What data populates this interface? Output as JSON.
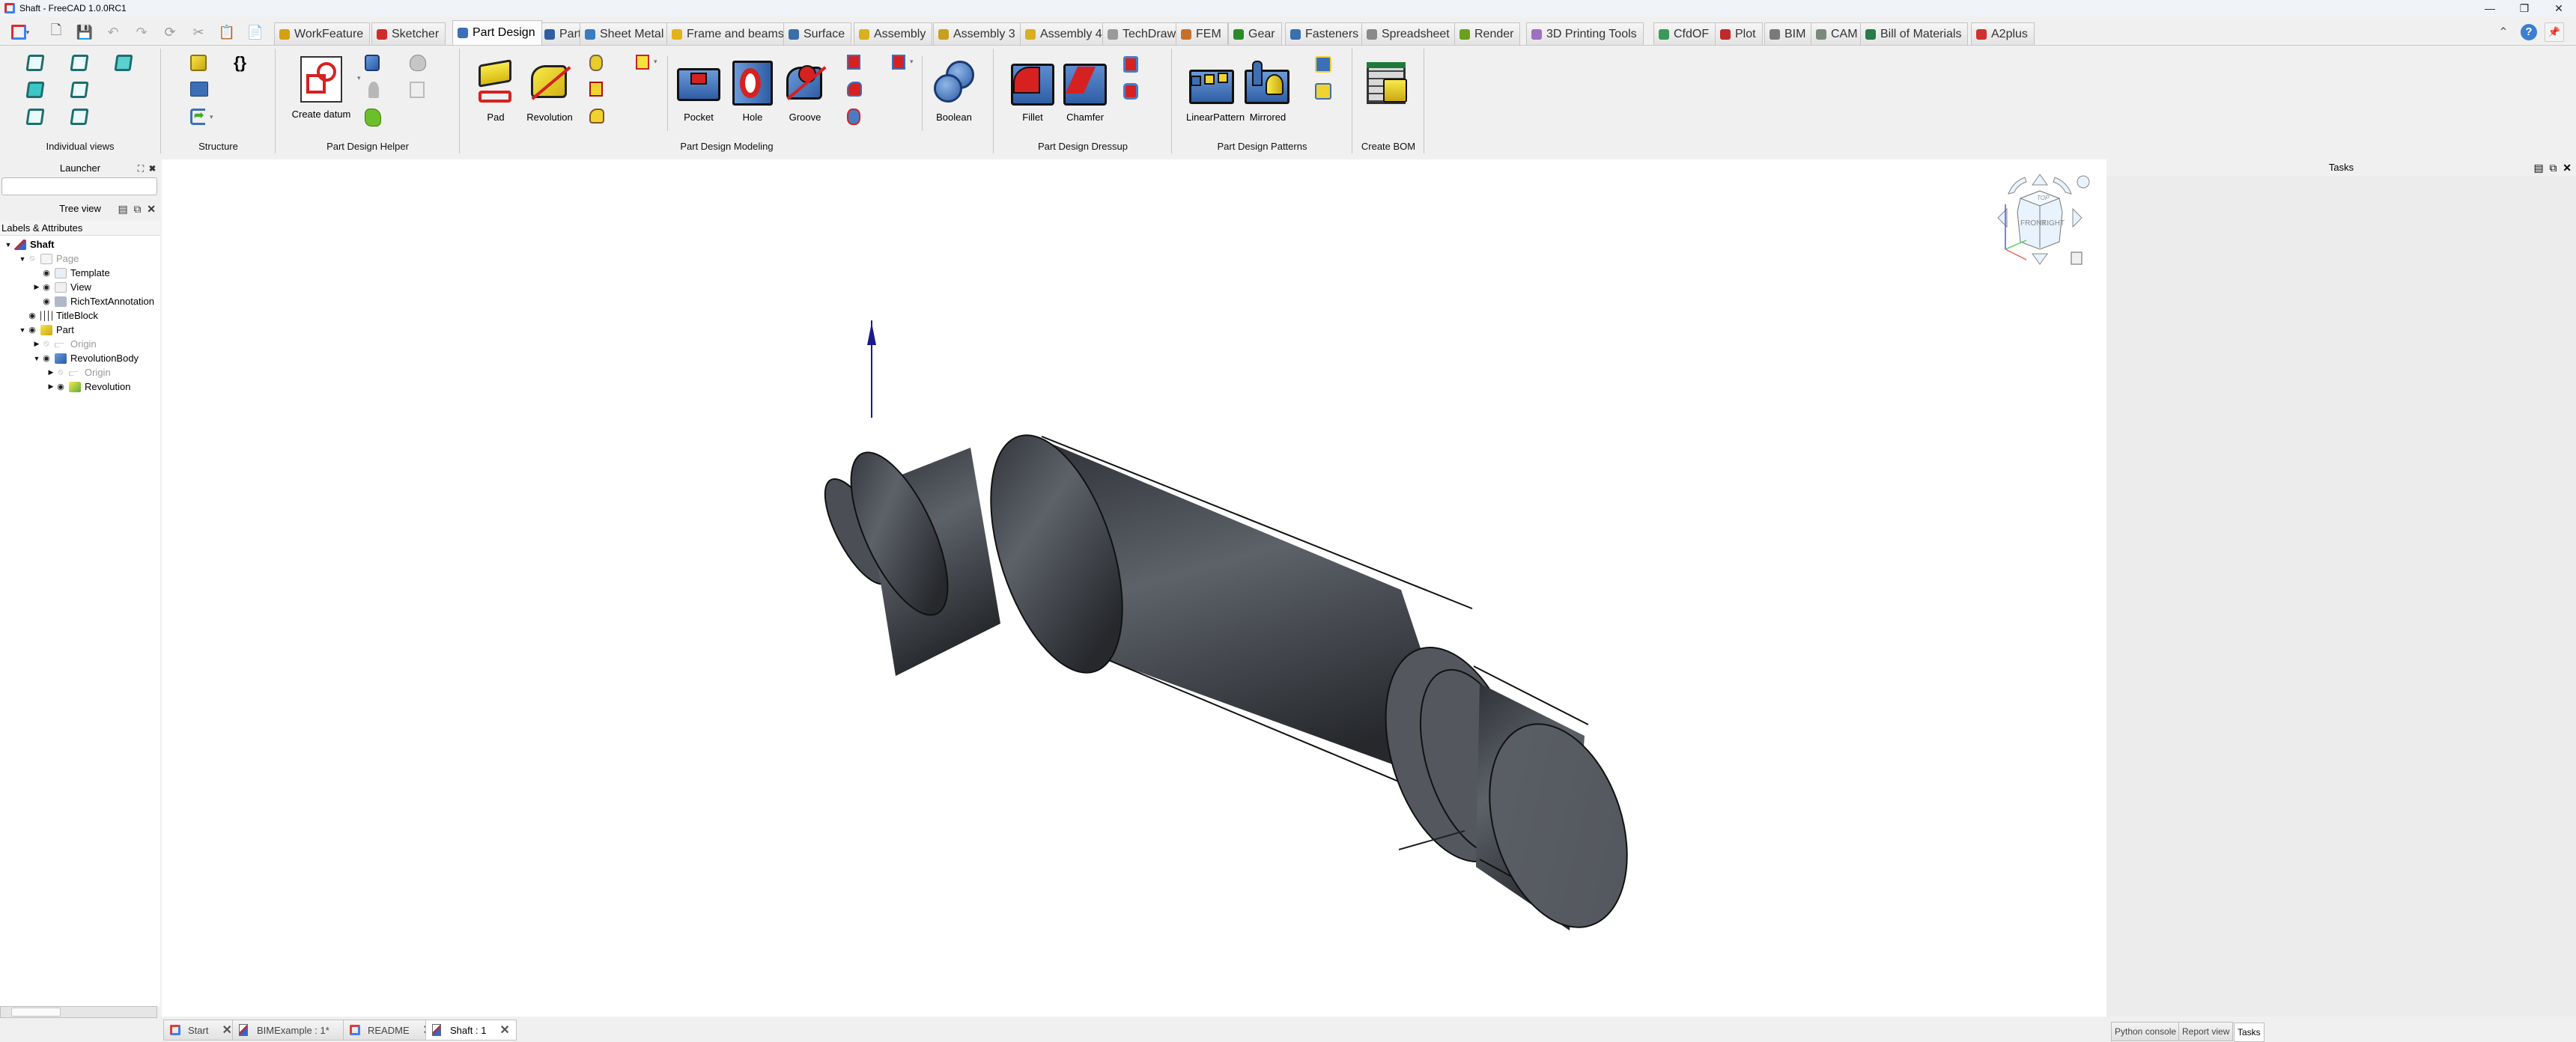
{
  "window": {
    "title": "Shaft - FreeCAD 1.0.0RC1",
    "controls": [
      "minimize",
      "restore",
      "close"
    ]
  },
  "quick_toolbar": [
    {
      "name": "freecad-menu",
      "icon": "freecad-logo-icon"
    },
    {
      "name": "new",
      "icon": "new-document-icon"
    },
    {
      "name": "save",
      "icon": "save-icon"
    },
    {
      "name": "undo",
      "icon": "undo-icon"
    },
    {
      "name": "redo",
      "icon": "redo-icon"
    },
    {
      "name": "refresh",
      "icon": "refresh-icon"
    },
    {
      "name": "cut",
      "icon": "cut-icon"
    },
    {
      "name": "copy",
      "icon": "copy-icon"
    },
    {
      "name": "paste",
      "icon": "paste-icon"
    }
  ],
  "workbench_tabs": [
    {
      "label": "WorkFeature",
      "color": "#d4a017"
    },
    {
      "label": "Sketcher",
      "color": "#d02a2a"
    },
    {
      "label": "Part Design",
      "color": "#3d6fb6",
      "active": true
    },
    {
      "label": "Part",
      "color": "#2f5fa0"
    },
    {
      "label": "Sheet Metal",
      "color": "#3b7bbf"
    },
    {
      "label": "Frame and beams",
      "color": "#e2b31a"
    },
    {
      "label": "Surface",
      "color": "#3b6ea8"
    },
    {
      "label": "Assembly",
      "color": "#d8b020"
    },
    {
      "label": "Assembly 3",
      "color": "#c8a020"
    },
    {
      "label": "Assembly 4",
      "color": "#d8b020"
    },
    {
      "label": "TechDraw",
      "color": "#9a9a9a"
    },
    {
      "label": "FEM",
      "color": "#c8702a"
    },
    {
      "label": "Gear",
      "color": "#2a8a2a"
    },
    {
      "label": "Fasteners",
      "color": "#3a6fb0"
    },
    {
      "label": "Spreadsheet",
      "color": "#8a8a8a"
    },
    {
      "label": "Render",
      "color": "#6aa020"
    },
    {
      "label": "3D Printing Tools",
      "color": "#a070c0"
    },
    {
      "label": "CfdOF",
      "color": "#3a9a5a"
    },
    {
      "label": "Plot",
      "color": "#c02a2a"
    },
    {
      "label": "BIM",
      "color": "#7a7a7a"
    },
    {
      "label": "CAM",
      "color": "#7a8a7a"
    },
    {
      "label": "Bill of Materials",
      "color": "#2a7a4a"
    },
    {
      "label": "A2plus",
      "color": "#d03030"
    }
  ],
  "ribbon_right": {
    "collapse": "chevron-up-icon",
    "help": "help-icon",
    "pin": "pin-icon"
  },
  "ribbon_groups": [
    {
      "label": "Individual views",
      "buttons": [
        "Isometric",
        "Front",
        "Top",
        "Right",
        "Rear",
        "Bottom",
        "Left"
      ]
    },
    {
      "label": "Structure",
      "buttons": [
        "Create part",
        "Create variable set",
        "Create group",
        "Link actions"
      ]
    },
    {
      "label": "Part Design Helper",
      "buttons": [
        {
          "label": "Create datum"
        },
        "Create body",
        "Shape binder",
        "Clone",
        "Sub-shape binder",
        "Validate sketch",
        "Create sketch"
      ]
    },
    {
      "label": "Part Design Modeling",
      "buttons": [
        {
          "label": "Pad"
        },
        {
          "label": "Revolution"
        },
        "Helix",
        "Loft",
        "Pipe",
        "Primitive",
        {
          "label": "Pocket"
        },
        {
          "label": "Hole"
        },
        {
          "label": "Groove"
        },
        "Subtractive loft",
        "Subtractive pipe",
        "Subtractive helix",
        "Subtractive primitive",
        {
          "label": "Boolean"
        }
      ]
    },
    {
      "label": "Part Design Dressup",
      "buttons": [
        {
          "label": "Fillet"
        },
        {
          "label": "Chamfer"
        },
        "Draft",
        "Thickness"
      ]
    },
    {
      "label": "Part Design Patterns",
      "buttons": [
        {
          "label": "LinearPattern"
        },
        {
          "label": "Mirrored"
        },
        "PolarPattern",
        "MultiTransform"
      ]
    },
    {
      "label": "Create BOM",
      "buttons": [
        "Bill of materials"
      ]
    }
  ],
  "launcher": {
    "title": "Launcher",
    "search_value": "",
    "search_placeholder": ""
  },
  "tree_view": {
    "title": "Tree view",
    "column_header": "Labels & Attributes",
    "items": [
      {
        "label": "Shaft",
        "depth": 0,
        "expanded": true,
        "bold": true,
        "icon": "document-icon"
      },
      {
        "label": "Page",
        "depth": 1,
        "expanded": true,
        "visible": false,
        "icon": "page-icon",
        "dim": true
      },
      {
        "label": "Template",
        "depth": 2,
        "visible": true,
        "icon": "template-icon"
      },
      {
        "label": "View",
        "depth": 2,
        "collapsed": true,
        "visible": true,
        "icon": "view-icon"
      },
      {
        "label": "RichTextAnnotation",
        "depth": 2,
        "visible": true,
        "icon": "annotation-icon"
      },
      {
        "label": "TitleBlock",
        "depth": 1,
        "visible": true,
        "icon": "spreadsheet-icon"
      },
      {
        "label": "Part",
        "depth": 1,
        "expanded": true,
        "visible": true,
        "icon": "part-icon"
      },
      {
        "label": "Origin",
        "depth": 2,
        "collapsed": true,
        "visible": false,
        "icon": "origin-icon",
        "dim": true
      },
      {
        "label": "RevolutionBody",
        "depth": 2,
        "expanded": true,
        "visible": true,
        "icon": "body-icon"
      },
      {
        "label": "Origin",
        "depth": 3,
        "collapsed": true,
        "visible": false,
        "icon": "origin-icon",
        "dim": true
      },
      {
        "label": "Revolution",
        "depth": 3,
        "collapsed": true,
        "visible": true,
        "icon": "revolution-icon"
      }
    ]
  },
  "viewport": {
    "background": "#ffffff",
    "model": "Shaft (revolved body)",
    "model_color": "#5a5f66",
    "axis_arrow_color": "#1a1a8c",
    "navcube_faces": [
      "TOP",
      "FRONT",
      "RIGHT"
    ]
  },
  "tasks_panel": {
    "title": "Tasks"
  },
  "document_tabs": [
    {
      "label": "Start",
      "icon": "freecad-logo-icon"
    },
    {
      "label": "BIMExample : 1*",
      "icon": "document-icon"
    },
    {
      "label": "README",
      "icon": "freecad-logo-icon"
    },
    {
      "label": "Shaft : 1",
      "icon": "document-icon",
      "active": true
    }
  ],
  "right_dock_tabs": [
    {
      "label": "Python console"
    },
    {
      "label": "Report view"
    },
    {
      "label": "Tasks",
      "active": true
    }
  ]
}
